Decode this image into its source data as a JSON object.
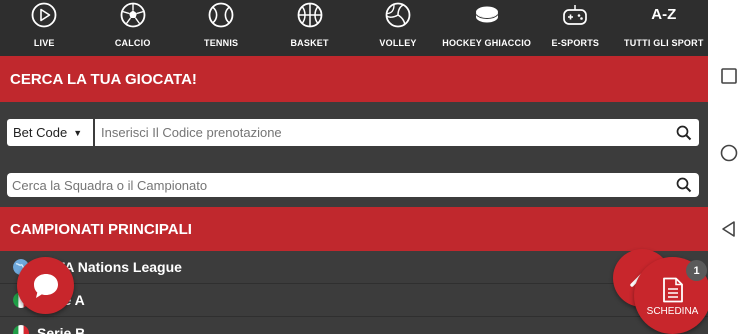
{
  "sports": [
    {
      "label": "LIVE",
      "icon": "play-circle-icon"
    },
    {
      "label": "CALCIO",
      "icon": "soccer-ball-icon"
    },
    {
      "label": "TENNIS",
      "icon": "tennis-ball-icon"
    },
    {
      "label": "BASKET",
      "icon": "basketball-icon"
    },
    {
      "label": "VOLLEY",
      "icon": "volleyball-icon"
    },
    {
      "label": "HOCKEY GHIACCIO",
      "icon": "hockey-puck-icon"
    },
    {
      "label": "E-SPORTS",
      "icon": "gamepad-icon"
    },
    {
      "label": "TUTTI GLI SPORT",
      "icon_text": "A-Z"
    }
  ],
  "search_section": {
    "title": "CERCA LA TUA GIOCATA!",
    "bet_code_label": "Bet Code",
    "code_placeholder": "Inserisci Il Codice prenotazione",
    "team_placeholder": "Cerca la Squadra o il Campionato"
  },
  "leagues_section": {
    "title": "CAMPIONATI PRINCIPALI",
    "items": [
      {
        "name": "UEFA Nations League",
        "flag": "globe-flag-icon"
      },
      {
        "name": "Serie A",
        "flag": "italy-flag-icon"
      },
      {
        "name": "Serie B",
        "flag": "italy-flag-icon"
      }
    ]
  },
  "bet_slip": {
    "label": "SCHEDINA",
    "count": "1"
  },
  "colors": {
    "accent": "#c0282d",
    "background": "#3c3c3c",
    "topbar": "#2e2e2e"
  }
}
